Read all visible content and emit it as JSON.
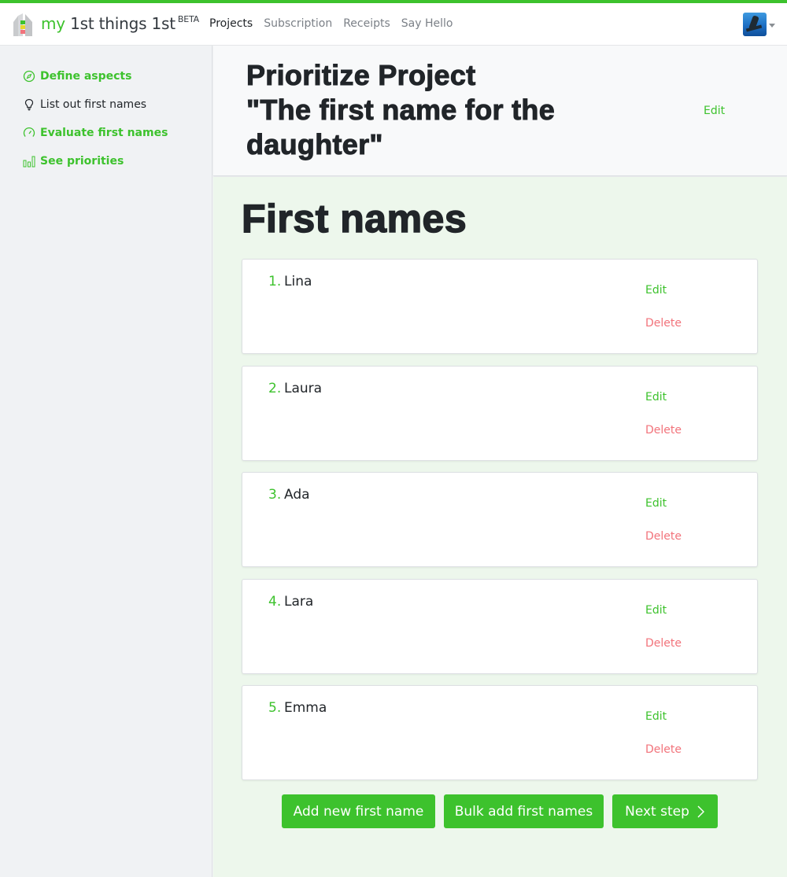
{
  "colors": {
    "brand_green": "#3dc22d",
    "danger_red": "#f2737b",
    "text_dark": "#212529"
  },
  "navbar": {
    "brand": {
      "prefix": "my",
      "name": "1st things 1st",
      "badge": "BETA"
    },
    "links": [
      {
        "label": "Projects",
        "active": true
      },
      {
        "label": "Subscription",
        "active": false
      },
      {
        "label": "Receipts",
        "active": false
      },
      {
        "label": "Say Hello",
        "active": false
      }
    ],
    "avatar": "user-avatar",
    "avatar_menu_icon": "caret-down-icon"
  },
  "sidebar": {
    "items": [
      {
        "label": "Define aspects",
        "icon": "compass-icon",
        "state": "done"
      },
      {
        "label": "List out first names",
        "icon": "lightbulb-icon",
        "state": "current"
      },
      {
        "label": "Evaluate first names",
        "icon": "gauge-icon",
        "state": "done"
      },
      {
        "label": "See priorities",
        "icon": "bar-chart-icon",
        "state": "done"
      }
    ]
  },
  "header": {
    "title_line1": "Prioritize Project",
    "title_line2": "\"The first name for the daughter\"",
    "edit_label": "Edit"
  },
  "main": {
    "section_title": "First names",
    "items": [
      {
        "number": "1.",
        "name": "Lina",
        "edit_label": "Edit",
        "delete_label": "Delete"
      },
      {
        "number": "2.",
        "name": "Laura",
        "edit_label": "Edit",
        "delete_label": "Delete"
      },
      {
        "number": "3.",
        "name": "Ada",
        "edit_label": "Edit",
        "delete_label": "Delete"
      },
      {
        "number": "4.",
        "name": "Lara",
        "edit_label": "Edit",
        "delete_label": "Delete"
      },
      {
        "number": "5.",
        "name": "Emma",
        "edit_label": "Edit",
        "delete_label": "Delete"
      }
    ],
    "buttons": {
      "add_new": "Add new first name",
      "bulk_add": "Bulk add first names",
      "next_step": "Next step"
    }
  }
}
